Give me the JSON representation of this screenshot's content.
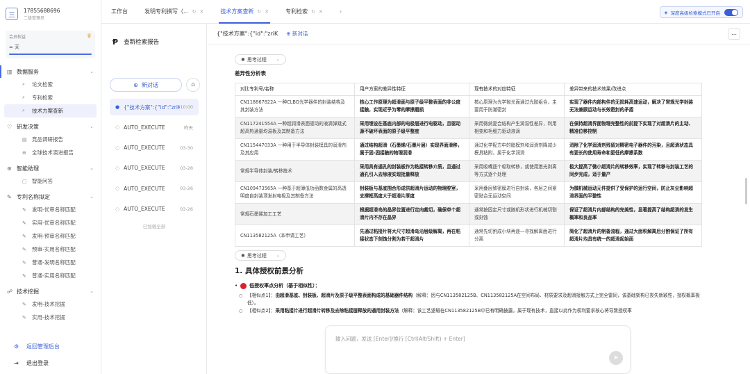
{
  "user": {
    "phone": "17855688696",
    "role": "二级管理员",
    "avatar_char": "三"
  },
  "member": {
    "label": "会员权益",
    "value": "∞ 天",
    "accent": "#4b6bde"
  },
  "sidebar": {
    "sections": [
      {
        "label": "数据服务",
        "items": [
          "论文检索",
          "专利检索",
          "技术方案查新"
        ]
      },
      {
        "label": "研发决策",
        "items": [
          "竞品调研报告",
          "全球技术演进报告"
        ]
      },
      {
        "label": "智能助理",
        "items": [
          "智能问答"
        ]
      },
      {
        "label": "专利名称拟定",
        "items": [
          "发明-优审名称匹配",
          "实用-优审名称匹配",
          "发明-预审名称匹配",
          "预审-实用名称匹配",
          "普通-发明名称匹配",
          "普通-实用名称匹配"
        ]
      },
      {
        "label": "技术挖掘",
        "items": [
          "发明-技术挖掘",
          "实用-技术挖掘"
        ]
      }
    ],
    "back_admin": "返回管理后台",
    "logout": "退出登录"
  },
  "tabs": [
    {
      "label": "工作台"
    },
    {
      "label": "发明专利撰写（..."
    },
    {
      "label": "技术方案查新"
    },
    {
      "label": "专利检索"
    }
  ],
  "toggle_label": "深度高级检索模式已开启",
  "history": {
    "title": "查新检索报告",
    "new_chat": "新对话",
    "items": [
      {
        "label": "{\"技术方案\":{\"id\":\"zriK",
        "time": "10:00"
      },
      {
        "label": "AUTO_EXECUTE",
        "time": "昨天"
      },
      {
        "label": "AUTO_EXECUTE",
        "time": "03-30"
      },
      {
        "label": "AUTO_EXECUTE",
        "time": "03-28"
      },
      {
        "label": "AUTO_EXECUTE",
        "time": "03-26"
      },
      {
        "label": "AUTO_EXECUTE",
        "time": "03-26"
      }
    ],
    "loaded_all": "已加载全部"
  },
  "main": {
    "query": "{\"技术方案\":{\"id\":\"zriK",
    "new_chat": "新对话",
    "thinking": "思考过程",
    "table_title": "差异性分析表",
    "columns": [
      "对比专利号/名称",
      "用户方案的差异性特征",
      "现有技术的对应特征",
      "差异带来的技术效果/改进点"
    ],
    "rows": [
      [
        "CN118867822A 一种CLBO光学器件的封装结构及其封装方法",
        "核心工作原理为超滑面与原子级平整表面的非公度接触，实现近乎为零的摩擦磨损",
        "核心原理为光学抛光面通过光胶组合，主要用于防潮密封",
        "实现了器件内部构件的无损耗高速运动，解决了常规光学封装无法兼顾运动与长效密封的矛盾"
      ],
      [
        "CN117241554A 一种超润滑表面驱动的液滴弹跳式超高热通量均温板及其制备方法",
        "采用埋设在基底内部的电极层进行电驱动，且驱动源不破坏表面的原子级平整度",
        "采用微纳复合结构产生润湿性差异，利用相变和毛细力驱动液滴",
        "在保持超滑界面物理完整性的前提下实现了对超滑片的主动、精准位移控制"
      ],
      [
        "CN115447033A 一种用于半导体封装模具的润滑剂及其应用",
        "通过结构超滑（石墨烯/石墨片层）实现界面滑移，属于固-固接触的物理润滑",
        "通过化学配方中的脂模剂和润滑剂降减少模具粘附，属于化学润滑",
        "消除了化学润滑剂残留对精密电子器件的污染，且超滑状态具有更长的使用寿命和更低的摩擦系数"
      ],
      [
        "常规半导体封装/转移技术",
        "采用具有通孔的封装板作为粘接转移介质，且通过通孔引入去除液实现批量释放",
        "采用吸嘴逐个吸取转移，或使用激光剥离等方式逐个处理",
        "极大提高了微小超滑片的转移效率，实现了转移与封装工艺的同步完成，适于量产"
      ],
      [
        "CN109473565A 一种基于超薄低功函数金属的高透明度自封装顶发射电极及其制备方法",
        "封装板与基底围合形成供超滑片运动的物理腔室，支撑框高度大于超滑片厚度",
        "采用叠层致密膜进行自封装，各层之间紧密贴合无运动空间",
        "为微机械运动元件提供了受保护的运行空间，防止灰尘影响超滑界面的平整性"
      ],
      [
        "常规石墨烯加工工艺",
        "根据超滑岛的晶界位置进行定向裁切，确保单个超滑片内不存在晶界",
        "通常按固定尺寸或随机形状进行机械切割或刻蚀",
        "保证了超滑片内部结构的完美性，显著提高了结构超滑的发生概率和良品率"
      ],
      [
        "CN113582125A（本申请工艺）",
        "先通过粘接片将大尺寸超滑岛沿层级解离，再在粘接状态下刻蚀分割为若干超滑片",
        "通常先切割成小块再逐一寻找解离面进行分离",
        "简化了超滑片的制备流程，通过大面积解离后分割保证了所有超滑片均具有统一的超滑起始面"
      ]
    ],
    "section_title": "1. 具体授权前景分析",
    "bullet": "低授权率点分析（基于相似性）：",
    "points": [
      {
        "label": "【相似点1】：",
        "bold": "由超滑基底、封装板、超滑片及原子级平整表面构成的基础器件结构",
        "rest": "（解释：因与CN113582125B、CN113582125A在空间布局、材质要求及超滑接触方式上完全雷同，该基础架构已丧失新颖性，授权概率极低）。"
      },
      {
        "label": "【相似点2】：",
        "bold": "采用粘接片进行超滑片转移及去除粘接层释放的通用封装方法",
        "rest": "（解释：该工艺逻辑在CN113582125B中已有明确披露，属于现有技术，直接以此作为权利要求核心将导致授权率"
      }
    ]
  },
  "input": {
    "placeholder": "输入问题，发送 [Enter]/换行 [Ctrl(Alt/Shift) + Enter]"
  }
}
